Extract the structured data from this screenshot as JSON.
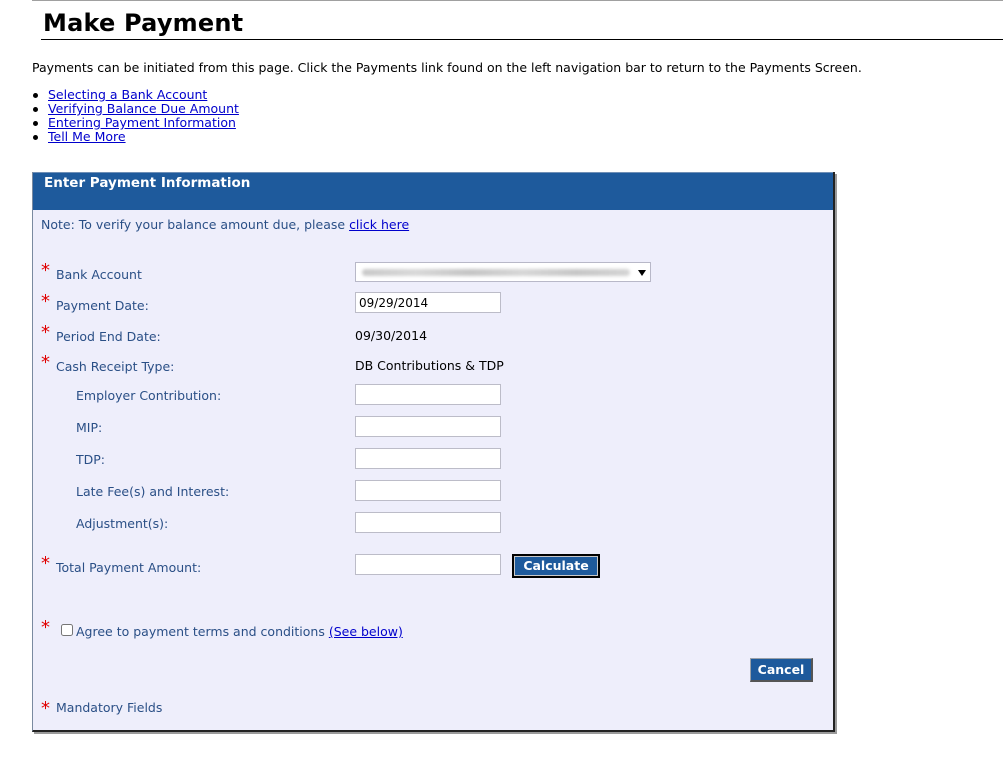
{
  "page": {
    "title": "Make Payment",
    "intro": "Payments can be initiated from this page. Click the Payments link found on the left navigation bar to return to the Payments Screen.",
    "help_links": [
      {
        "label": "Selecting a Bank Account"
      },
      {
        "label": "Verifying Balance Due Amount"
      },
      {
        "label": "Entering Payment Information"
      },
      {
        "label": "Tell Me More"
      }
    ]
  },
  "panel": {
    "title": "Enter Payment Information",
    "note_prefix": "Note: To verify your balance amount due, please ",
    "note_link": "click here",
    "required_marker": "*",
    "fields": {
      "bank_account": {
        "label": "Bank Account",
        "value": "(redacted / blurred account)"
      },
      "payment_date": {
        "label": "Payment Date:",
        "value": "09/29/2014"
      },
      "period_end_date": {
        "label": "Period End Date:",
        "value": "09/30/2014"
      },
      "cash_receipt_type": {
        "label": "Cash Receipt Type:",
        "value": "DB Contributions & TDP"
      },
      "employer_contribution": {
        "label": "Employer Contribution:",
        "value": ""
      },
      "mip": {
        "label": "MIP:",
        "value": ""
      },
      "tdp": {
        "label": "TDP:",
        "value": ""
      },
      "late_fees": {
        "label": "Late Fee(s) and Interest:",
        "value": ""
      },
      "adjustments": {
        "label": "Adjustment(s):",
        "value": ""
      },
      "total_payment": {
        "label": "Total Payment Amount:",
        "value": ""
      }
    },
    "calculate_label": "Calculate",
    "agree": {
      "label": "Agree to payment terms and conditions ",
      "link": "(See below)",
      "checked": false
    },
    "cancel_label": "Cancel",
    "mandatory_label": "Mandatory Fields"
  },
  "colors": {
    "header_blue": "#1e5a9c",
    "panel_bg": "#eeeefb",
    "label_blue": "#2a4f86",
    "required_red": "#e00000",
    "link_blue": "#0000cc"
  }
}
